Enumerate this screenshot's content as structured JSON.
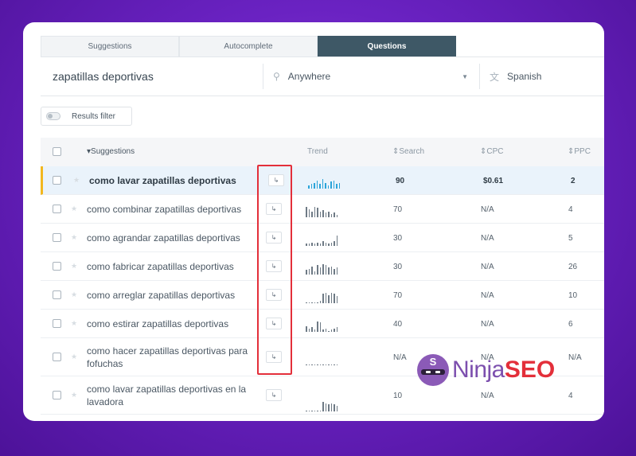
{
  "tabs": [
    "Suggestions",
    "Autocomplete",
    "Questions"
  ],
  "search": {
    "keyword": "zapatillas deportivas",
    "location": "Anywhere",
    "language": "Spanish"
  },
  "filter_label": "Results filter",
  "columns": {
    "suggestions": "Suggestions",
    "trend": "Trend",
    "search": "Search",
    "cpc": "CPC",
    "ppc": "PPC"
  },
  "rows": [
    {
      "text": "como lavar zapatillas deportivas",
      "search": "90",
      "cpc": "$0.61",
      "ppc": "2",
      "trend": [
        3,
        4,
        5,
        7,
        4,
        8,
        5,
        3,
        6,
        7,
        4,
        5
      ]
    },
    {
      "text": "como combinar zapatillas deportivas",
      "search": "70",
      "cpc": "N/A",
      "ppc": "4",
      "trend": [
        9,
        7,
        5,
        9,
        8,
        5,
        6,
        4,
        5,
        3,
        4,
        2
      ]
    },
    {
      "text": "como agrandar zapatillas deportivas",
      "search": "30",
      "cpc": "N/A",
      "ppc": "5",
      "trend": [
        2,
        2,
        3,
        2,
        3,
        2,
        4,
        3,
        2,
        3,
        4,
        9
      ]
    },
    {
      "text": "como fabricar zapatillas deportivas",
      "search": "30",
      "cpc": "N/A",
      "ppc": "26",
      "trend": [
        4,
        5,
        7,
        3,
        8,
        6,
        9,
        8,
        6,
        7,
        5,
        6
      ]
    },
    {
      "text": "como arreglar zapatillas deportivas",
      "search": "70",
      "cpc": "N/A",
      "ppc": "10",
      "trend": [
        0.5,
        0.5,
        0.5,
        0.5,
        0.5,
        2,
        8,
        9,
        7,
        9,
        8,
        6
      ]
    },
    {
      "text": "como estirar zapatillas deportivas",
      "search": "40",
      "cpc": "N/A",
      "ppc": "6",
      "trend": [
        5,
        3,
        4,
        2,
        9,
        8,
        2,
        3,
        1,
        2,
        3,
        4
      ]
    },
    {
      "text": "como hacer zapatillas deportivas para fofuchas",
      "search": "N/A",
      "cpc": "N/A",
      "ppc": "N/A",
      "trend": [
        0.5,
        0.5,
        0.5,
        0.5,
        0.5,
        0.5,
        0.5,
        0.5,
        0.5,
        0.5,
        0.5,
        0.5
      ]
    },
    {
      "text": "como lavar zapatillas deportivas en la lavadora",
      "search": "10",
      "cpc": "N/A",
      "ppc": "4",
      "trend": [
        0.5,
        0.5,
        0.5,
        0.5,
        0.5,
        1,
        8,
        7,
        6,
        7,
        6,
        5
      ]
    }
  ],
  "brand": {
    "part1": "Ninja",
    "part2": "SEO",
    "logo_letter": "S"
  },
  "colors": {
    "accent": "#3e5866",
    "highlight": "#e32f3a",
    "selected_bar": "#f2b71f",
    "trend_active": "#2ba4d9"
  }
}
